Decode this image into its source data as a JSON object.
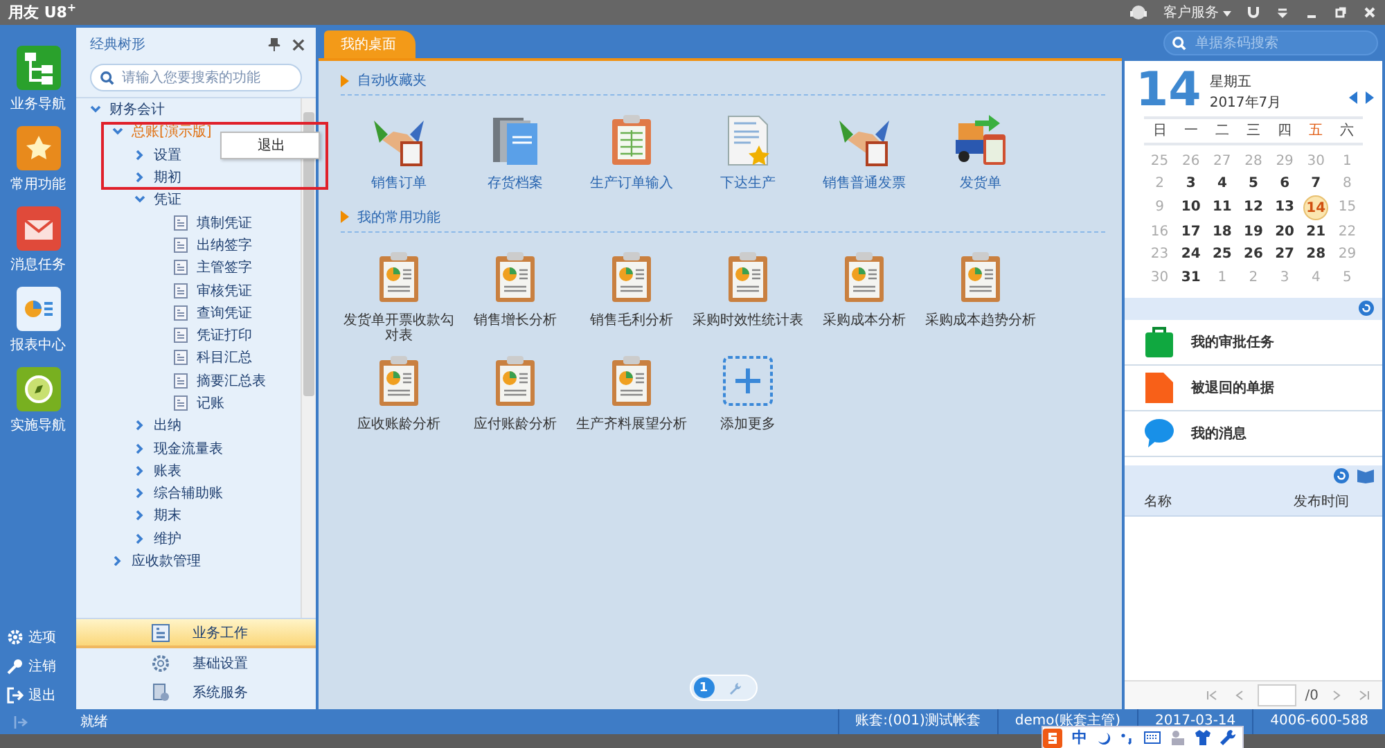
{
  "title_bar": {
    "app_name": "用友 U8",
    "superscript": "+",
    "service": "客户服务"
  },
  "nav": [
    {
      "label": "业务导航",
      "kind": "tree"
    },
    {
      "label": "常用功能",
      "kind": "star"
    },
    {
      "label": "消息任务",
      "kind": "mail"
    },
    {
      "label": "报表中心",
      "kind": "report"
    },
    {
      "label": "实施导航",
      "kind": "compass"
    }
  ],
  "nav_bottom": [
    {
      "label": "选项",
      "kind": "gear"
    },
    {
      "label": "注销",
      "kind": "key"
    },
    {
      "label": "退出",
      "kind": "exit"
    }
  ],
  "tree_panel": {
    "title": "经典树形",
    "search_placeholder": "请输入您要搜索的功能",
    "tree": [
      {
        "label": "财务会计",
        "kind": "folder",
        "expanded": true,
        "selected": false,
        "children": [
          {
            "label": "总账[演示版]",
            "kind": "folder",
            "expanded": true,
            "selected": true,
            "children": [
              {
                "label": "设置",
                "kind": "folder",
                "expanded": false,
                "selected": false
              },
              {
                "label": "期初",
                "kind": "folder",
                "expanded": false,
                "selected": false
              },
              {
                "label": "凭证",
                "kind": "folder",
                "expanded": true,
                "selected": false,
                "children": [
                  {
                    "label": "填制凭证",
                    "kind": "leaf",
                    "selected": false
                  },
                  {
                    "label": "出纳签字",
                    "kind": "leaf",
                    "selected": false
                  },
                  {
                    "label": "主管签字",
                    "kind": "leaf",
                    "selected": false
                  },
                  {
                    "label": "审核凭证",
                    "kind": "leaf",
                    "selected": false
                  },
                  {
                    "label": "查询凭证",
                    "kind": "leaf",
                    "selected": false
                  },
                  {
                    "label": "凭证打印",
                    "kind": "leaf",
                    "selected": false
                  },
                  {
                    "label": "科目汇总",
                    "kind": "leaf",
                    "selected": false
                  },
                  {
                    "label": "摘要汇总表",
                    "kind": "leaf",
                    "selected": false
                  },
                  {
                    "label": "记账",
                    "kind": "leaf",
                    "selected": false
                  }
                ]
              },
              {
                "label": "出纳",
                "kind": "folder",
                "expanded": false,
                "selected": false
              },
              {
                "label": "现金流量表",
                "kind": "folder",
                "expanded": false,
                "selected": false
              },
              {
                "label": "账表",
                "kind": "folder",
                "expanded": false,
                "selected": false
              },
              {
                "label": "综合辅助账",
                "kind": "folder",
                "expanded": false,
                "selected": false
              },
              {
                "label": "期末",
                "kind": "folder",
                "expanded": false,
                "selected": false
              },
              {
                "label": "维护",
                "kind": "folder",
                "expanded": false,
                "selected": false
              }
            ]
          },
          {
            "label": "应收款管理",
            "kind": "folder",
            "expanded": false,
            "selected": false
          }
        ]
      }
    ],
    "context_menu": [
      "退出"
    ],
    "modules": [
      {
        "label": "业务工作",
        "kind": "work",
        "selected": true
      },
      {
        "label": "基础设置",
        "kind": "gear",
        "selected": false
      },
      {
        "label": "系统服务",
        "kind": "service",
        "selected": false
      }
    ]
  },
  "tabs": [
    {
      "label": "我的桌面",
      "selected": true
    }
  ],
  "doc_search": {
    "placeholder": "单据条码搜索"
  },
  "sections": [
    {
      "title": "自动收藏夹",
      "items": [
        {
          "label": "销售订单",
          "kind": "handshake"
        },
        {
          "label": "存货档案",
          "kind": "books"
        },
        {
          "label": "生产订单输入",
          "kind": "clipboard"
        },
        {
          "label": "下达生产",
          "kind": "starpage"
        },
        {
          "label": "销售普通发票",
          "kind": "handshake"
        },
        {
          "label": "发货单",
          "kind": "truck"
        }
      ]
    },
    {
      "title": "我的常用功能",
      "items": [
        {
          "label": "发货单开票收款勾对表",
          "kind": "report"
        },
        {
          "label": "销售增长分析",
          "kind": "report"
        },
        {
          "label": "销售毛利分析",
          "kind": "report"
        },
        {
          "label": "采购时效性统计表",
          "kind": "report"
        },
        {
          "label": "采购成本分析",
          "kind": "report"
        },
        {
          "label": "采购成本趋势分析",
          "kind": "report"
        },
        {
          "label": "应收账龄分析",
          "kind": "report"
        },
        {
          "label": "应付账龄分析",
          "kind": "report"
        },
        {
          "label": "生产齐料展望分析",
          "kind": "report"
        },
        {
          "label": "添加更多",
          "kind": "add"
        }
      ]
    }
  ],
  "pages": [
    {
      "label": "1",
      "selected": true
    }
  ],
  "calendar": {
    "day": "14",
    "weekday": "星期五",
    "month": "2017年7月",
    "headers": [
      {
        "label": "日",
        "highlight": false
      },
      {
        "label": "一",
        "highlight": false
      },
      {
        "label": "二",
        "highlight": false
      },
      {
        "label": "三",
        "highlight": false
      },
      {
        "label": "四",
        "highlight": false
      },
      {
        "label": "五",
        "highlight": true
      },
      {
        "label": "六",
        "highlight": false
      }
    ],
    "weeks": [
      [
        {
          "day": "25",
          "muted": true,
          "selected": false
        },
        {
          "day": "26",
          "muted": true,
          "selected": false
        },
        {
          "day": "27",
          "muted": true,
          "selected": false
        },
        {
          "day": "28",
          "muted": true,
          "selected": false
        },
        {
          "day": "29",
          "muted": true,
          "selected": false
        },
        {
          "day": "30",
          "muted": true,
          "selected": false
        },
        {
          "day": "1",
          "muted": true,
          "selected": false
        }
      ],
      [
        {
          "day": "2",
          "muted": true,
          "selected": false
        },
        {
          "day": "3",
          "muted": false,
          "selected": false
        },
        {
          "day": "4",
          "muted": false,
          "selected": false
        },
        {
          "day": "5",
          "muted": false,
          "selected": false
        },
        {
          "day": "6",
          "muted": false,
          "selected": false
        },
        {
          "day": "7",
          "muted": false,
          "selected": false
        },
        {
          "day": "8",
          "muted": true,
          "selected": false
        }
      ],
      [
        {
          "day": "9",
          "muted": true,
          "selected": false
        },
        {
          "day": "10",
          "muted": false,
          "selected": false
        },
        {
          "day": "11",
          "muted": false,
          "selected": false
        },
        {
          "day": "12",
          "muted": false,
          "selected": false
        },
        {
          "day": "13",
          "muted": false,
          "selected": false
        },
        {
          "day": "14",
          "muted": false,
          "selected": true
        },
        {
          "day": "15",
          "muted": true,
          "selected": false
        }
      ],
      [
        {
          "day": "16",
          "muted": true,
          "selected": false
        },
        {
          "day": "17",
          "muted": false,
          "selected": false
        },
        {
          "day": "18",
          "muted": false,
          "selected": false
        },
        {
          "day": "19",
          "muted": false,
          "selected": false
        },
        {
          "day": "20",
          "muted": false,
          "selected": false
        },
        {
          "day": "21",
          "muted": false,
          "selected": false
        },
        {
          "day": "22",
          "muted": true,
          "selected": false
        }
      ],
      [
        {
          "day": "23",
          "muted": true,
          "selected": false
        },
        {
          "day": "24",
          "muted": false,
          "selected": false
        },
        {
          "day": "25",
          "muted": false,
          "selected": false
        },
        {
          "day": "26",
          "muted": false,
          "selected": false
        },
        {
          "day": "27",
          "muted": false,
          "selected": false
        },
        {
          "day": "28",
          "muted": false,
          "selected": false
        },
        {
          "day": "29",
          "muted": true,
          "selected": false
        }
      ],
      [
        {
          "day": "30",
          "muted": true,
          "selected": false
        },
        {
          "day": "31",
          "muted": false,
          "selected": false
        },
        {
          "day": "1",
          "muted": true,
          "selected": false
        },
        {
          "day": "2",
          "muted": true,
          "selected": false
        },
        {
          "day": "3",
          "muted": true,
          "selected": false
        },
        {
          "day": "4",
          "muted": true,
          "selected": false
        },
        {
          "day": "5",
          "muted": true,
          "selected": false
        }
      ]
    ]
  },
  "tasks": [
    {
      "label": "我的审批任务",
      "kind": "briefcase"
    },
    {
      "label": "被退回的单据",
      "kind": "document"
    },
    {
      "label": "我的消息",
      "kind": "chat"
    }
  ],
  "notices": {
    "columns": [
      "名称",
      "发布时间"
    ],
    "page_total": "/0"
  },
  "status_bar": {
    "state": "就绪",
    "cells": [
      "账套:(001)测试帐套",
      "demo(账套主管)",
      "2017-03-14",
      "4006-600-588"
    ]
  },
  "ime": {
    "mode": "中"
  }
}
